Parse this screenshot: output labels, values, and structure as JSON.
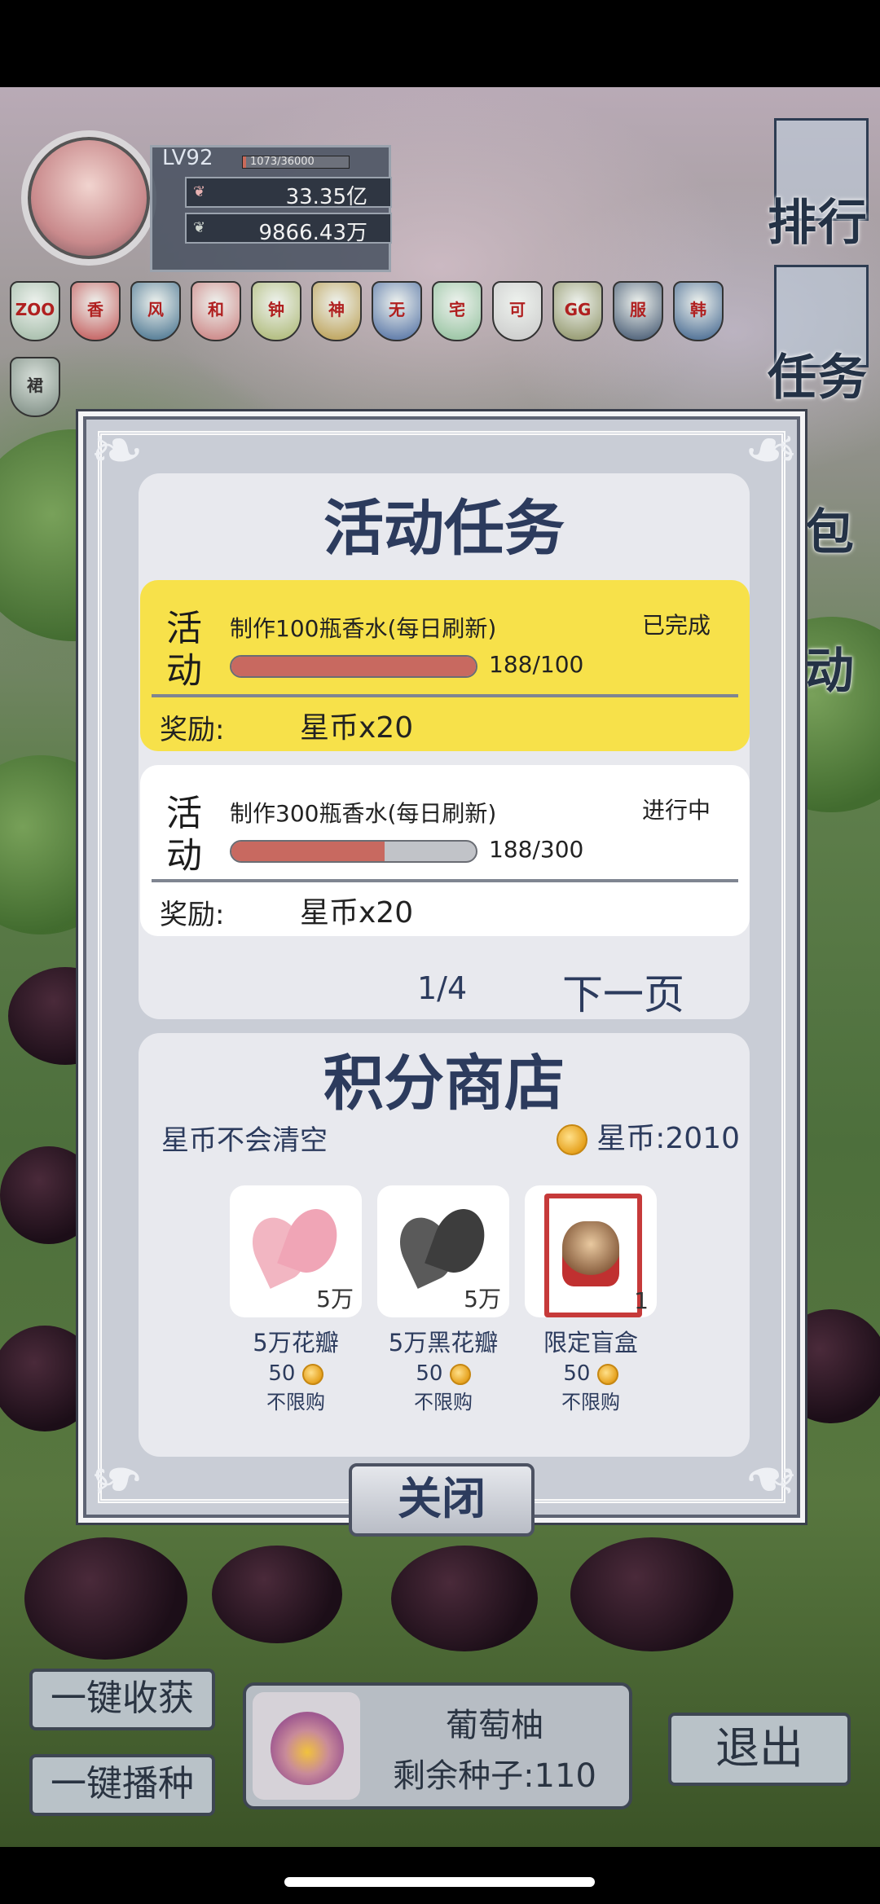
{
  "player": {
    "level": "LV92",
    "xp_text": "1073/36000",
    "xp_fraction": 0.03,
    "petals": "33.35亿",
    "dark_petals": "9866.43万"
  },
  "badges": [
    "ZOO",
    "香",
    "风",
    "和",
    "钟",
    "神",
    "无",
    "宅",
    "可",
    "GG",
    "服",
    "韩"
  ],
  "extra_badge": "裙",
  "side_menu": {
    "rank": "排行",
    "tasks": "任务",
    "bag": "包",
    "activity": "动"
  },
  "tasks": {
    "title": "活动任务",
    "items": [
      {
        "tag": "活动",
        "name": "制作100瓶香水(每日刷新)",
        "status": "已完成",
        "progress_text": "188/100",
        "progress_fraction": 1.0,
        "reward_label": "奖励:",
        "reward_value": "星币x20"
      },
      {
        "tag": "活动",
        "name": "制作300瓶香水(每日刷新)",
        "status": "进行中",
        "progress_text": "188/300",
        "progress_fraction": 0.627,
        "reward_label": "奖励:",
        "reward_value": "星币x20"
      }
    ],
    "page": "1/4",
    "next_page": "下一页"
  },
  "shop": {
    "title": "积分商店",
    "note": "星币不会清空",
    "coins_text": "星币:2010",
    "items": [
      {
        "name": "5万花瓣",
        "qty": "5万",
        "price": "50",
        "limit": "不限购"
      },
      {
        "name": "5万黑花瓣",
        "qty": "5万",
        "price": "50",
        "limit": "不限购"
      },
      {
        "name": "限定盲盒",
        "qty": "1",
        "price": "50",
        "limit": "不限购"
      }
    ]
  },
  "close_label": "关闭",
  "bottom": {
    "harvest_all": "一键收获",
    "plant_all": "一键播种",
    "seed_name": "葡萄柚",
    "seed_count": "剩余种子:110",
    "exit": "退出"
  },
  "colors": {
    "highlight": "#f7e14a",
    "progress_fill": "#c86960",
    "title_text": "#2c3b5d"
  }
}
